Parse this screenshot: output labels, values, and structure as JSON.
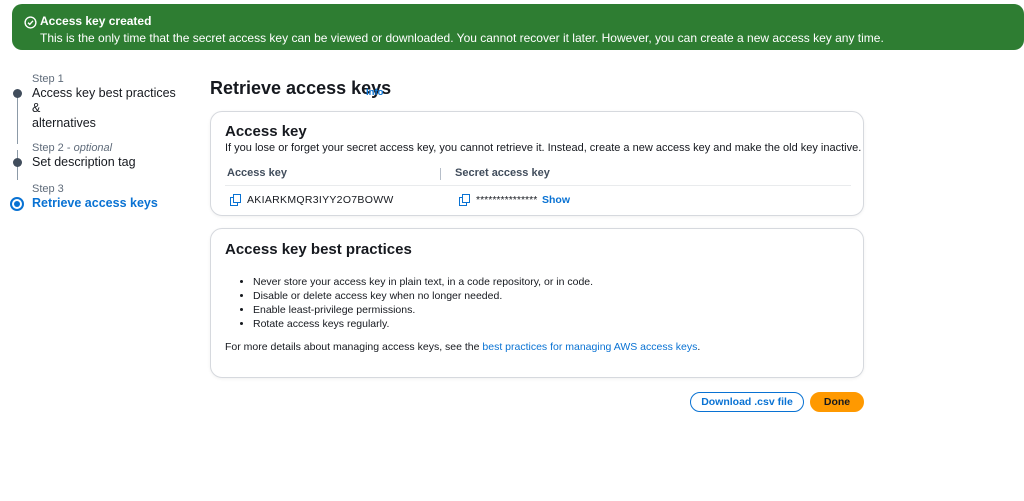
{
  "flash": {
    "title": "Access key created",
    "message": "This is the only time that the secret access key can be viewed or downloaded. You cannot recover it later. However, you can create a new access key any time.",
    "color": "#2e7d32"
  },
  "steps": [
    {
      "num": "Step 1",
      "optional": "",
      "label": "Access key best practices &",
      "label2": "alternatives"
    },
    {
      "num": "Step 2 - ",
      "optional": "optional",
      "label": "Set description tag"
    },
    {
      "num": "Step 3",
      "optional": "",
      "label": "Retrieve access keys"
    }
  ],
  "page": {
    "title": "Retrieve access keys",
    "info": "Info"
  },
  "access_key_panel": {
    "title": "Access key",
    "description": "If you lose or forget your secret access key, you cannot retrieve it. Instead, create a new access key and make the old key inactive.",
    "col_access": "Access key",
    "col_secret": "Secret access key",
    "access_key_value": "AKIARKMQR3IYY2O7BOWW",
    "secret_value": "***************",
    "show_label": "Show"
  },
  "best_practices_panel": {
    "title": "Access key best practices",
    "items": [
      "Never store your access key in plain text, in a code repository, or in code.",
      "Disable or delete access key when no longer needed.",
      "Enable least-privilege permissions.",
      "Rotate access keys regularly."
    ],
    "more_prefix": "For more details about managing access keys, see the ",
    "more_link": "best practices for managing AWS access keys",
    "more_suffix": "."
  },
  "buttons": {
    "download": "Download .csv file",
    "done": "Done"
  },
  "colors": {
    "link": "#0972d3",
    "primary_button": "#ff9900"
  }
}
